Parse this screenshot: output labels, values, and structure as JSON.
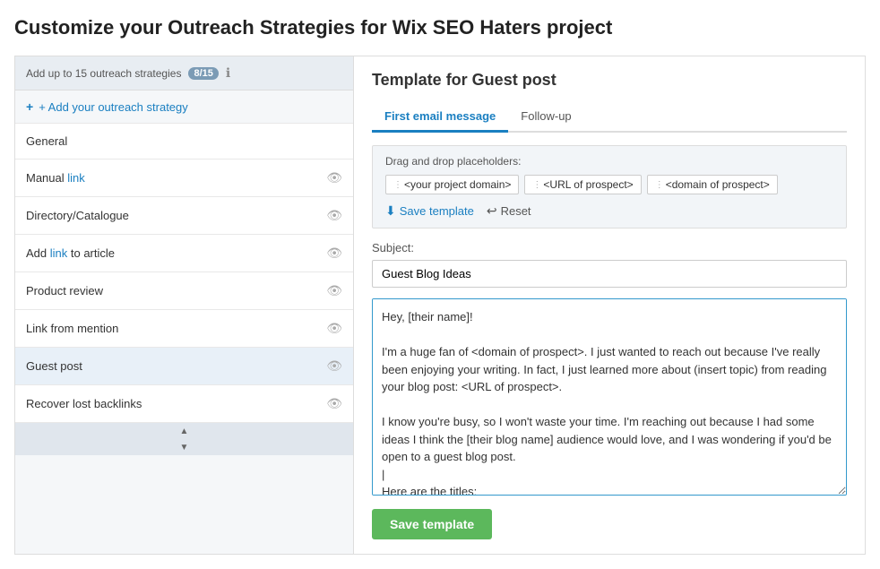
{
  "page": {
    "title": "Customize your Outreach Strategies for Wix SEO Haters project"
  },
  "sidebar": {
    "header_text": "Add up to 15 outreach strategies",
    "badge": "8/15",
    "add_label": "+ Add your outreach strategy",
    "items": [
      {
        "id": "general",
        "label": "General",
        "has_eye": false,
        "active": false
      },
      {
        "id": "manual-link",
        "label": "Manual link",
        "has_eye": true,
        "active": false,
        "link_word": "link"
      },
      {
        "id": "directory",
        "label": "Directory/Catalogue",
        "has_eye": true,
        "active": false
      },
      {
        "id": "add-link",
        "label": "Add link to article",
        "has_eye": true,
        "active": false,
        "link_word": "link"
      },
      {
        "id": "product-review",
        "label": "Product review",
        "has_eye": true,
        "active": false
      },
      {
        "id": "link-from-mention",
        "label": "Link from mention",
        "has_eye": true,
        "active": false
      },
      {
        "id": "guest-post",
        "label": "Guest post",
        "has_eye": true,
        "active": true
      },
      {
        "id": "recover-backlinks",
        "label": "Recover lost backlinks",
        "has_eye": true,
        "active": false
      }
    ]
  },
  "content": {
    "template_title": "Template for Guest post",
    "tabs": [
      {
        "id": "first-email",
        "label": "First email message",
        "active": true
      },
      {
        "id": "follow-up",
        "label": "Follow-up",
        "active": false
      }
    ],
    "placeholders_label": "Drag and drop placeholders:",
    "placeholders": [
      {
        "id": "project-domain",
        "label": "<your project domain>"
      },
      {
        "id": "url-prospect",
        "label": "<URL of prospect>"
      },
      {
        "id": "domain-prospect",
        "label": "<domain of prospect>"
      }
    ],
    "save_template_small_label": "Save template",
    "reset_label": "Reset",
    "subject_label": "Subject:",
    "subject_value": "Guest Blog Ideas",
    "email_body": "Hey, [their name]!\n\nI'm a huge fan of <domain of prospect>. I just wanted to reach out because I've really been enjoying your writing. In fact, I just learned more about (insert topic) from reading your blog post: <URL of prospect>.\n\nI know you're busy, so I won't waste your time. I'm reaching out because I had some ideas I think the [their blog name] audience would love, and I was wondering if you'd be open to a guest blog post.\n|\nHere are the titles:\n(List Titles)",
    "save_template_btn_label": "Save template"
  }
}
